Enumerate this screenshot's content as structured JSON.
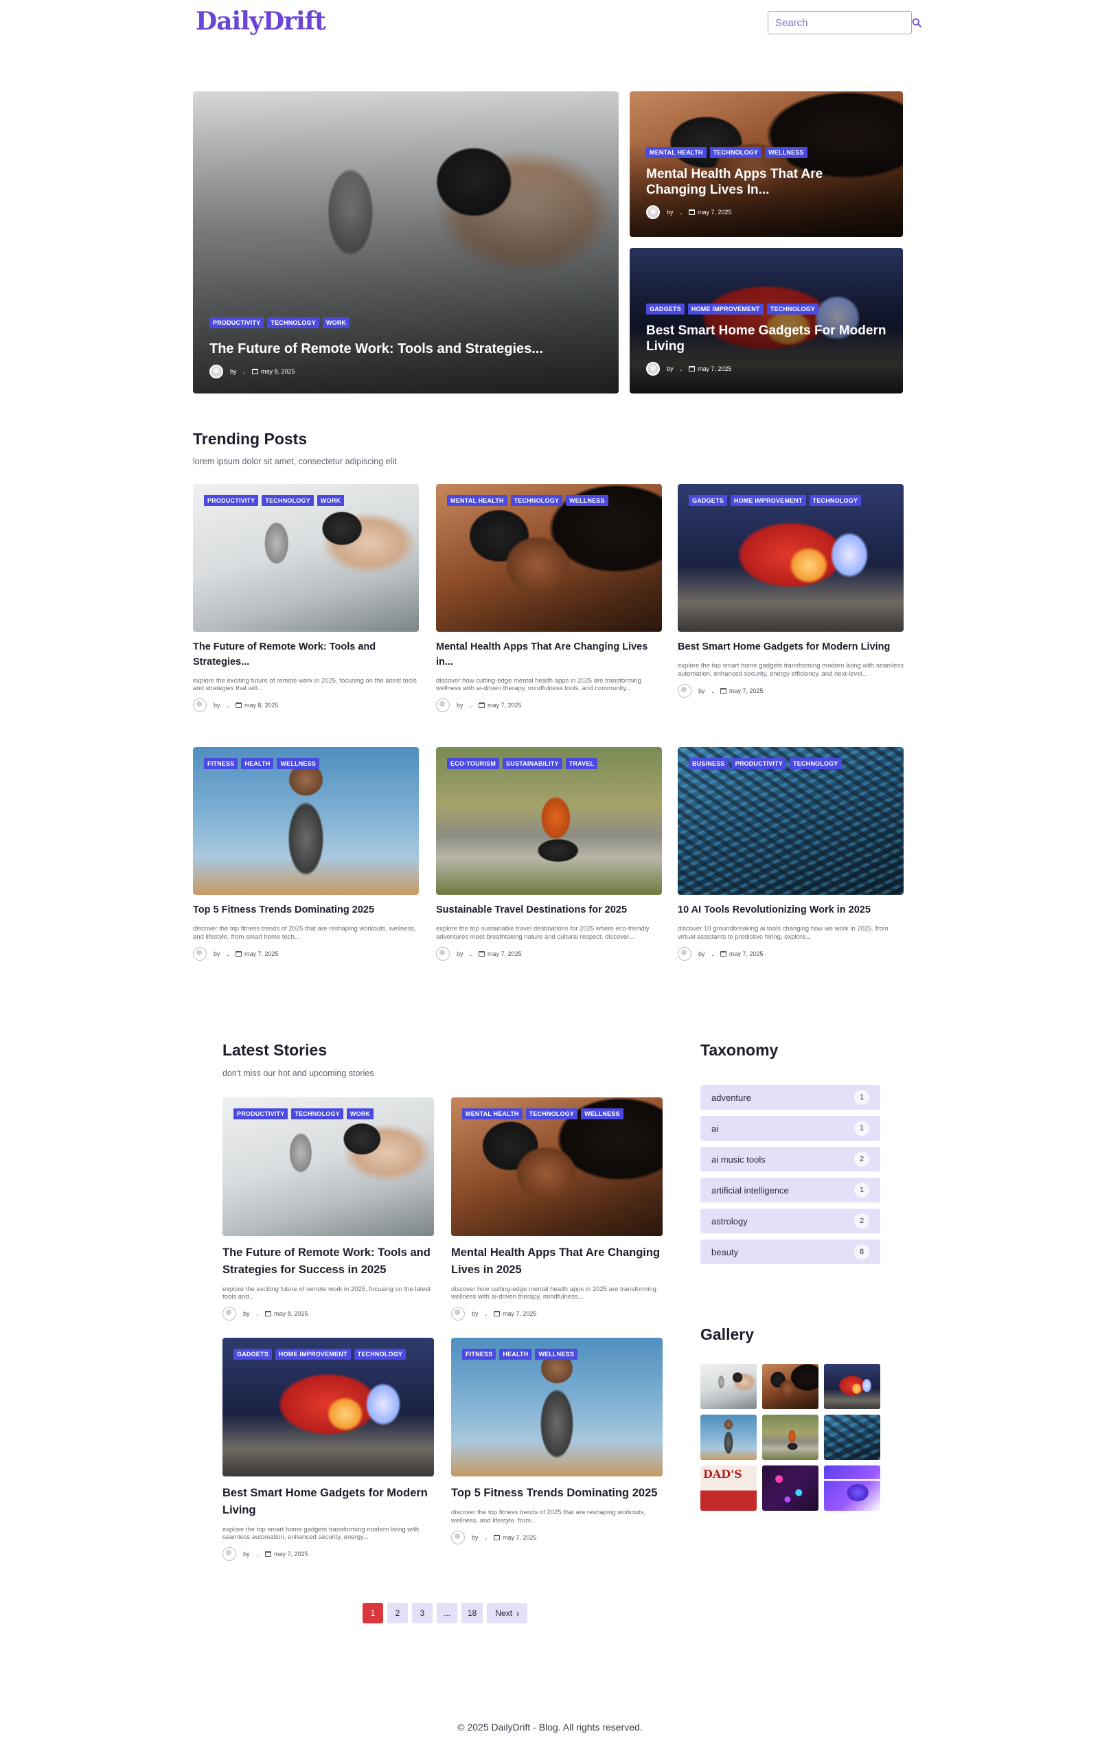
{
  "site": {
    "logo": "DailyDrift"
  },
  "search": {
    "placeholder": "Search"
  },
  "hero": {
    "main": {
      "tags": [
        "PRODUCTIVITY",
        "TECHNOLOGY",
        "WORK"
      ],
      "title": "The Future of Remote Work: Tools and Strategies...",
      "by": "by",
      "author": ".",
      "date": "may 8, 2025"
    },
    "side1": {
      "tags": [
        "MENTAL HEALTH",
        "TECHNOLOGY",
        "WELLNESS"
      ],
      "title": "Mental Health Apps That Are Changing Lives In...",
      "by": "by",
      "author": ".",
      "date": "may 7, 2025"
    },
    "side2": {
      "tags": [
        "GADGETS",
        "HOME IMPROVEMENT",
        "TECHNOLOGY"
      ],
      "title": "Best Smart Home Gadgets For Modern Living",
      "by": "by",
      "author": ".",
      "date": "may 7, 2025"
    }
  },
  "trending": {
    "title": "Trending Posts",
    "subtitle": "lorem ipsum dolor sit amet, consectetur adipiscing elit",
    "cards": [
      {
        "tags": [
          "PRODUCTIVITY",
          "TECHNOLOGY",
          "WORK"
        ],
        "title": "The Future of Remote Work: Tools and Strategies...",
        "excerpt": "explore the exciting future of remote work in 2025, focusing on the latest tools and strategies that will...",
        "by": "by",
        "author": ".",
        "date": "may 8, 2025",
        "image": "microphone-podcast"
      },
      {
        "tags": [
          "MENTAL HEALTH",
          "TECHNOLOGY",
          "WELLNESS"
        ],
        "title": "Mental Health Apps That Are Changing Lives in...",
        "excerpt": "discover how cutting-edge mental health apps in 2025 are transforming wellness with ai-driven therapy, mindfulness tools, and community...",
        "by": "by",
        "author": ".",
        "date": "may 7, 2025",
        "image": "woman-smartwatch"
      },
      {
        "tags": [
          "GADGETS",
          "HOME IMPROVEMENT",
          "TECHNOLOGY"
        ],
        "title": "Best Smart Home Gadgets for Modern Living",
        "excerpt": "explore the top smart home gadgets transforming modern living with seamless automation, enhanced security, energy efficiency, and next-level...",
        "by": "by",
        "author": ".",
        "date": "may 7, 2025",
        "image": "smart-display"
      },
      {
        "tags": [
          "FITNESS",
          "HEALTH",
          "WELLNESS"
        ],
        "title": "Top 5 Fitness Trends Dominating 2025",
        "excerpt": "discover the top fitness trends of 2025 that are reshaping workouts, wellness, and lifestyle. from smart home tech...",
        "by": "by",
        "author": ".",
        "date": "may 7, 2025",
        "image": "fitness-woman"
      },
      {
        "tags": [
          "ECO-TOURISM",
          "SUSTAINABILITY",
          "TRAVEL"
        ],
        "title": "Sustainable Travel Destinations for 2025",
        "excerpt": "explore the top sustainable travel destinations for 2025 where eco-friendly adventures meet breathtaking nature and cultural respect. discover...",
        "by": "by",
        "author": ".",
        "date": "may 7, 2025",
        "image": "cyclist-travel"
      },
      {
        "tags": [
          "BUSINESS",
          "PRODUCTIVITY",
          "TECHNOLOGY"
        ],
        "title": "10 AI Tools Revolutionizing Work in 2025",
        "excerpt": "discover 10 groundbreaking ai tools changing how we work in 2025. from virtual assistants to predictive hiring, explore...",
        "by": "by",
        "author": ".",
        "date": "may 7, 2025",
        "image": "circuit-chips"
      }
    ]
  },
  "latest": {
    "title": "Latest Stories",
    "subtitle": "don't miss our hot and upcoming stories",
    "cards": [
      {
        "tags": [
          "PRODUCTIVITY",
          "TECHNOLOGY",
          "WORK"
        ],
        "title": "The Future of Remote Work: Tools and Strategies for Success in 2025",
        "excerpt": "explore the exciting future of remote work in 2025, focusing on the latest tools and...",
        "by": "by",
        "author": ".",
        "date": "may 8, 2025",
        "image": "microphone-podcast"
      },
      {
        "tags": [
          "MENTAL HEALTH",
          "TECHNOLOGY",
          "WELLNESS"
        ],
        "title": "Mental Health Apps That Are Changing Lives in 2025",
        "excerpt": "discover how cutting-edge mental health apps in 2025 are transforming wellness with ai-driven therapy, mindfulness...",
        "by": "by",
        "author": ".",
        "date": "may 7, 2025",
        "image": "woman-smartwatch"
      },
      {
        "tags": [
          "GADGETS",
          "HOME IMPROVEMENT",
          "TECHNOLOGY"
        ],
        "title": "Best Smart Home Gadgets for Modern Living",
        "excerpt": "explore the top smart home gadgets transforming modern living with seamless automation, enhanced security, energy...",
        "by": "by",
        "author": ".",
        "date": "may 7, 2025",
        "image": "smart-display"
      },
      {
        "tags": [
          "FITNESS",
          "HEALTH",
          "WELLNESS"
        ],
        "title": "Top 5 Fitness Trends Dominating 2025",
        "excerpt": "discover the top fitness trends of 2025 that are reshaping workouts, wellness, and lifestyle. from...",
        "by": "by",
        "author": ".",
        "date": "may 7, 2025",
        "image": "fitness-woman"
      }
    ]
  },
  "taxonomy": {
    "title": "Taxonomy",
    "items": [
      {
        "label": "adventure",
        "count": "1"
      },
      {
        "label": "ai",
        "count": "1"
      },
      {
        "label": "ai music tools",
        "count": "2"
      },
      {
        "label": "artificial intelligence",
        "count": "1"
      },
      {
        "label": "astrology",
        "count": "2"
      },
      {
        "label": "beauty",
        "count": "8"
      }
    ]
  },
  "gallery": {
    "title": "Gallery",
    "items": [
      "microphone-podcast",
      "woman-smartwatch",
      "smart-display",
      "fitness-woman",
      "cyclist-travel",
      "circuit-chips",
      "dads-works-poster",
      "neon-icons",
      "app-interface"
    ],
    "dads_text": "DAD'S"
  },
  "pagination": {
    "pages": [
      "1",
      "2",
      "3",
      "...",
      "18"
    ],
    "next": "Next",
    "current": "1"
  },
  "footer": {
    "text": "© 2025 DailyDrift - Blog. All rights reserved."
  },
  "colors": {
    "brand": "#6a45d8",
    "tag": "#4a4ae0",
    "pill": "#e2e1f7",
    "active_page": "#d9363e"
  }
}
